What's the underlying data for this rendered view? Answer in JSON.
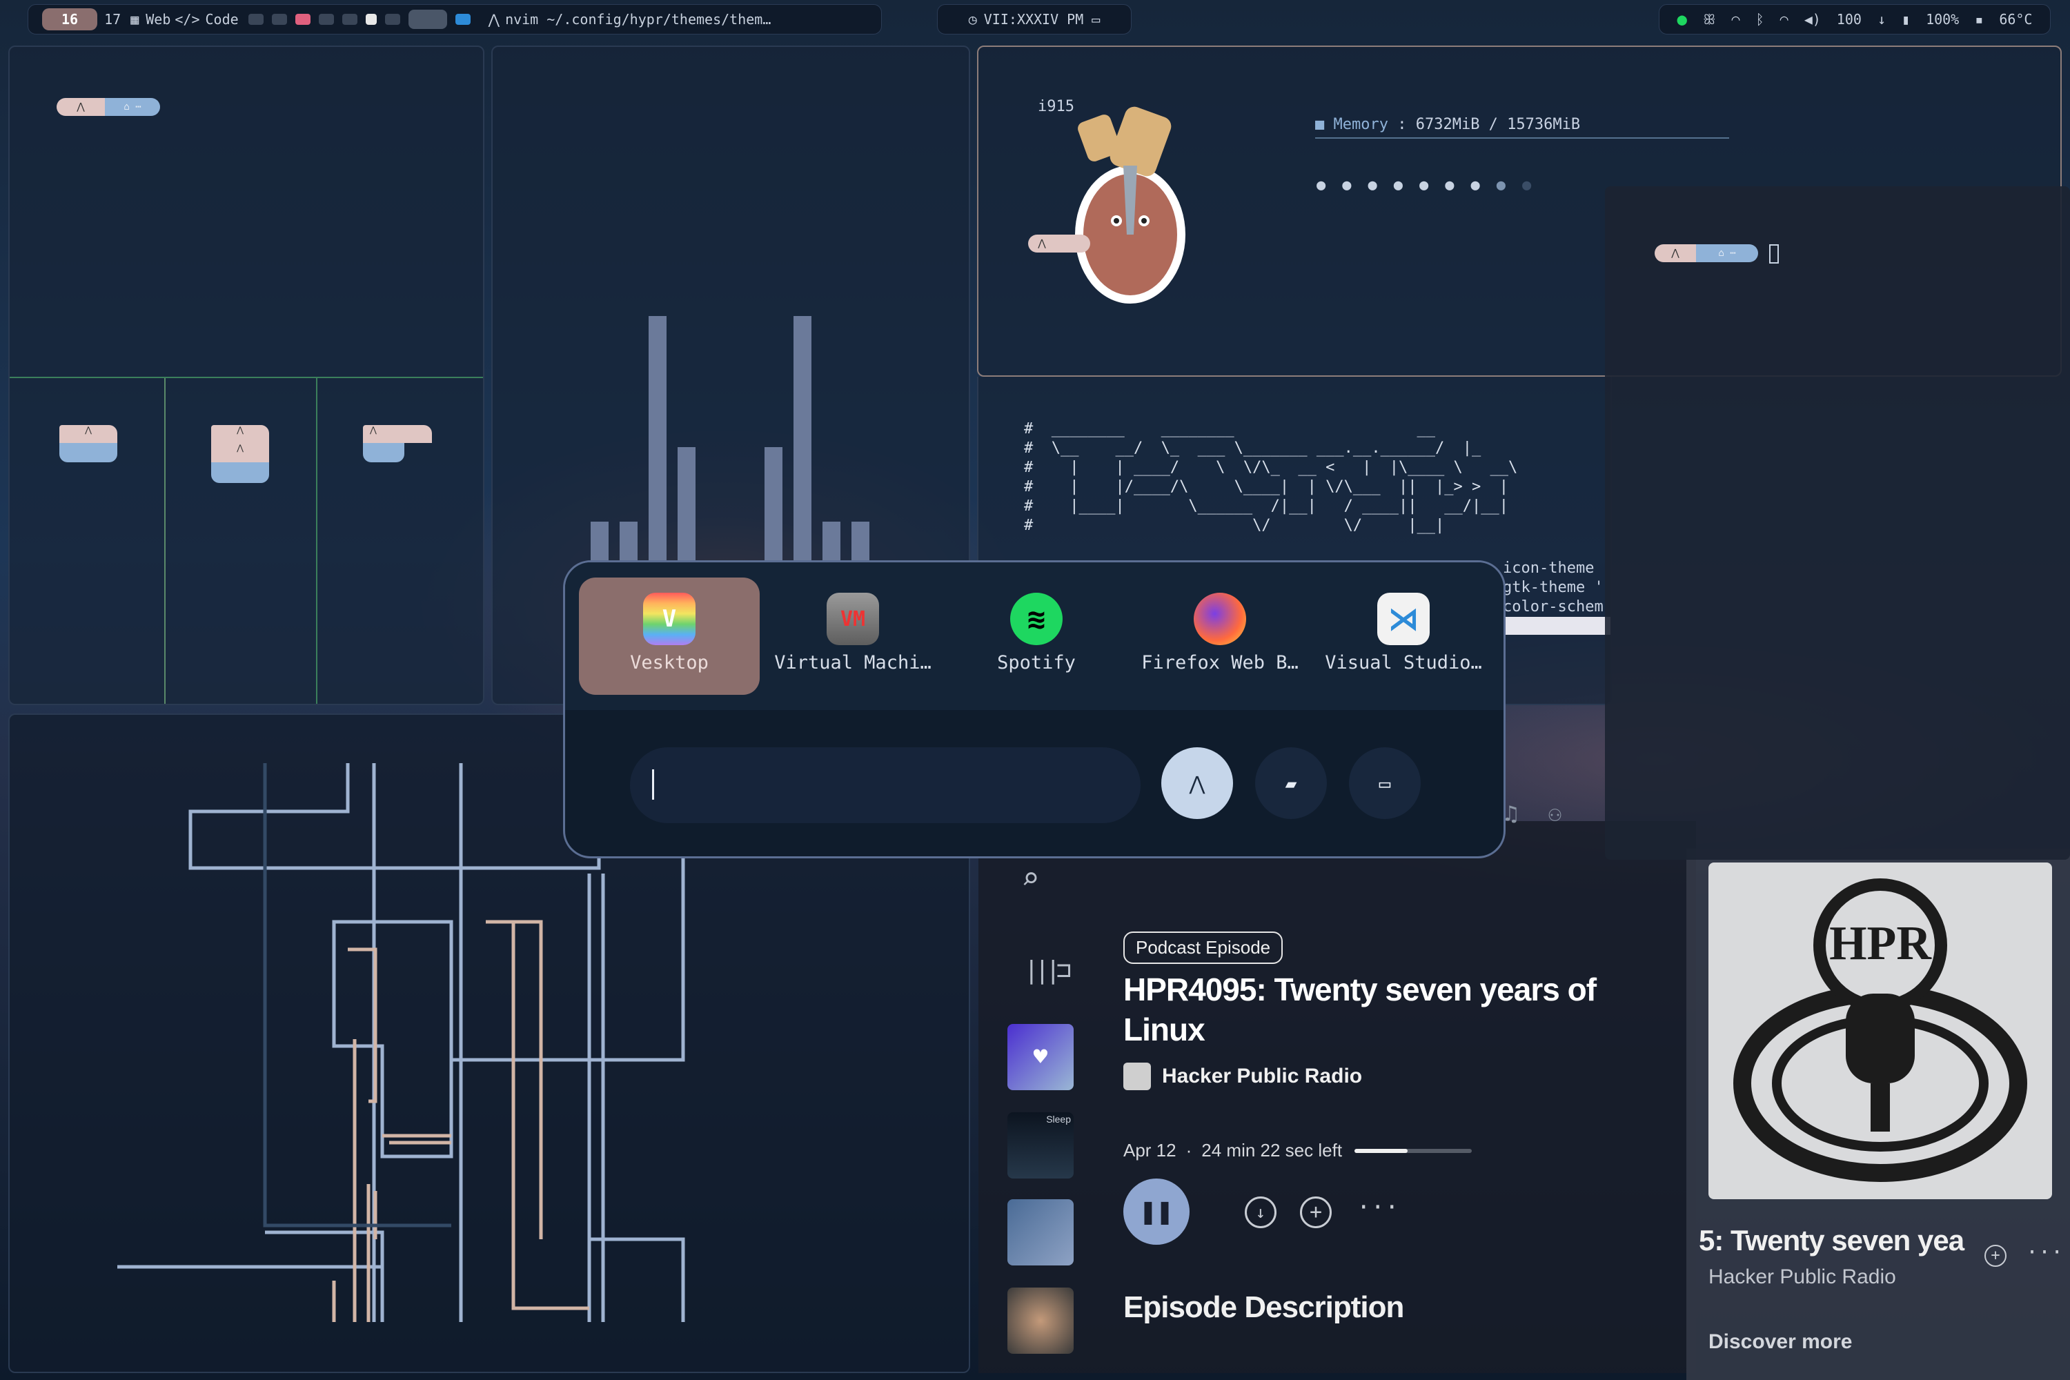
{
  "topbar": {
    "workspaces": [
      "16",
      "17"
    ],
    "ws_web": "Web",
    "ws_code": "Code",
    "window_title": "nvim ~/.config/hypr/themes/them…",
    "clock": "VII:XXXIV PM",
    "volume": "100",
    "battery": "100%",
    "temp": "66°C"
  },
  "fastfetch": {
    "host_prefix": "i915",
    "memory_label": "Memory",
    "memory_value": ": 6732MiB / 15736MiB"
  },
  "editor": {
    "lines": [
      "icon-theme",
      "gtk-theme '",
      "color-schem"
    ]
  },
  "launcher": {
    "apps": [
      {
        "label": "Vesktop",
        "icon": "vesktop-icon",
        "color": "#c8a0ff"
      },
      {
        "label": "Virtual Machi…",
        "icon": "virt-manager-icon",
        "color": "#8c8c8c"
      },
      {
        "label": "Spotify",
        "icon": "spotify-icon",
        "color": "#1ed760"
      },
      {
        "label": "Firefox Web B…",
        "icon": "firefox-icon",
        "color": "#ff6a3d"
      },
      {
        "label": "Visual Studio…",
        "icon": "vscode-icon",
        "color": "#2d8bd8"
      }
    ],
    "search_value": ""
  },
  "spotify": {
    "tag": "Podcast Episode",
    "title": "HPR4095: Twenty seven years of Linux",
    "show": "Hacker Public Radio",
    "date": "Apr 12",
    "remaining": "24 min 22 sec left",
    "progress": 0.45,
    "section": "Episode Description",
    "side_title": "5: Twenty seven yea",
    "side_show": "Hacker Public Radio",
    "discover": "Discover more",
    "sleep_label": "Sleep"
  },
  "colors": {
    "accent": "#8b6e6c",
    "launcher_border": "#5b6e93",
    "spotify_green": "#1ed760"
  }
}
